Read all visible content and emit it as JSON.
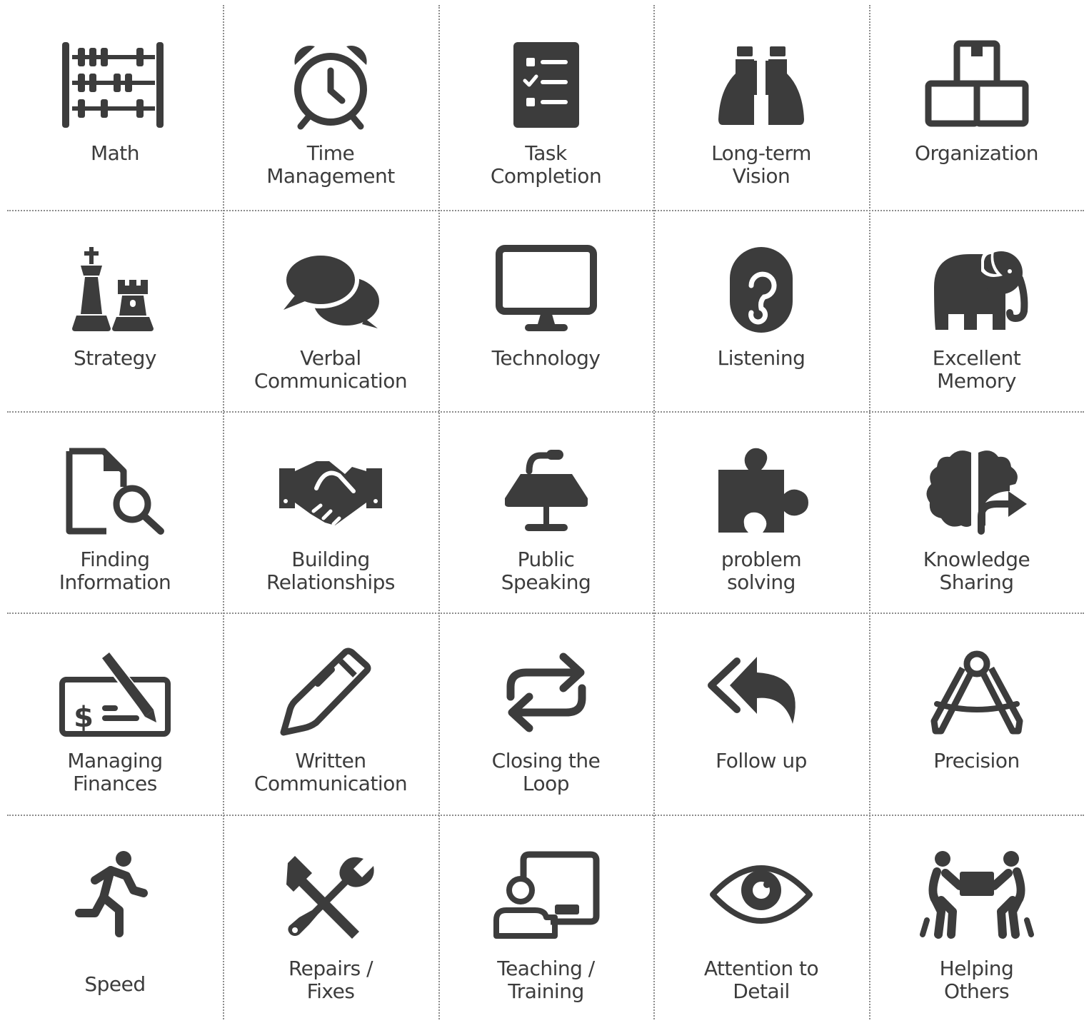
{
  "colors": {
    "icon": "#3c3c3c",
    "text": "#3c3c3c",
    "gridline": "#8c8c8c",
    "background": "#ffffff"
  },
  "cells": [
    {
      "icon": "abacus-icon",
      "lines": [
        "Math"
      ]
    },
    {
      "icon": "alarm-clock-icon",
      "lines": [
        "Time",
        "Management"
      ]
    },
    {
      "icon": "checklist-icon",
      "lines": [
        "Task",
        "Completion"
      ]
    },
    {
      "icon": "binoculars-icon",
      "lines": [
        "Long-term",
        "Vision"
      ]
    },
    {
      "icon": "boxes-icon",
      "lines": [
        "Organization"
      ]
    },
    {
      "icon": "chess-pieces-icon",
      "lines": [
        "Strategy"
      ]
    },
    {
      "icon": "speech-bubbles-icon",
      "lines": [
        "Verbal",
        "Communication"
      ]
    },
    {
      "icon": "monitor-icon",
      "lines": [
        "Technology"
      ]
    },
    {
      "icon": "ear-icon",
      "lines": [
        "Listening"
      ]
    },
    {
      "icon": "elephant-icon",
      "lines": [
        "Excellent",
        "Memory"
      ]
    },
    {
      "icon": "document-search-icon",
      "lines": [
        "Finding",
        "Information"
      ]
    },
    {
      "icon": "handshake-icon",
      "lines": [
        "Building",
        "Relationships"
      ]
    },
    {
      "icon": "lectern-icon",
      "lines": [
        "Public",
        "Speaking"
      ]
    },
    {
      "icon": "puzzle-piece-icon",
      "lines": [
        "problem",
        "solving"
      ]
    },
    {
      "icon": "brain-share-icon",
      "lines": [
        "Knowledge",
        "Sharing"
      ]
    },
    {
      "icon": "check-pen-icon",
      "lines": [
        "Managing",
        "Finances"
      ]
    },
    {
      "icon": "pen-icon",
      "lines": [
        "Written",
        "Communication"
      ]
    },
    {
      "icon": "loop-arrows-icon",
      "lines": [
        "Closing the",
        "Loop"
      ]
    },
    {
      "icon": "reply-all-icon",
      "lines": [
        "Follow up"
      ]
    },
    {
      "icon": "compass-icon",
      "lines": [
        "Precision"
      ]
    },
    {
      "icon": "runner-icon",
      "lines": [
        "Speed"
      ]
    },
    {
      "icon": "tools-icon",
      "lines": [
        "Repairs /",
        "Fixes"
      ]
    },
    {
      "icon": "teacher-board-icon",
      "lines": [
        "Teaching /",
        "Training"
      ]
    },
    {
      "icon": "eye-icon",
      "lines": [
        "Attention to",
        "Detail"
      ]
    },
    {
      "icon": "people-carrying-box-icon",
      "lines": [
        "Helping",
        "Others"
      ]
    }
  ]
}
